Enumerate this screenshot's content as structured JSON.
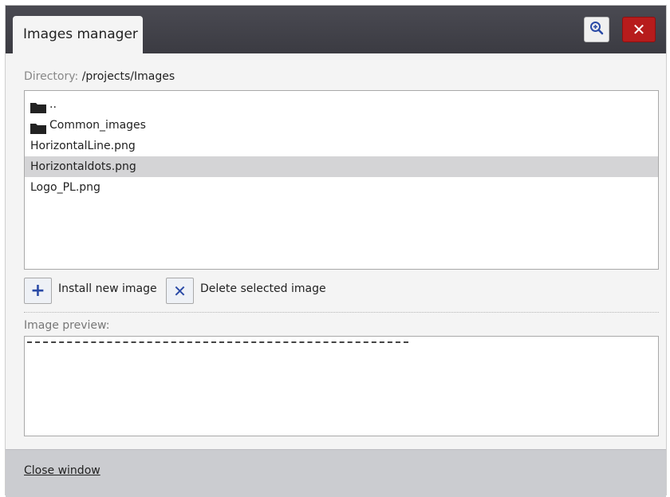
{
  "window": {
    "title": "Images manager"
  },
  "header": {
    "zoom_icon": "zoom-in-icon",
    "close_icon": "close-icon",
    "close_glyph": "✕",
    "close_color": "#b71c1c"
  },
  "directory": {
    "label": "Directory:",
    "path": "/projects/Images"
  },
  "files": [
    {
      "name": "..",
      "type": "folder"
    },
    {
      "name": "Common_images",
      "type": "folder"
    },
    {
      "name": "HorizontalLine.png",
      "type": "file"
    },
    {
      "name": "Horizontaldots.png",
      "type": "file",
      "selected": true
    },
    {
      "name": "Logo_PL.png",
      "type": "file"
    }
  ],
  "actions": {
    "install_label": "Install new image",
    "install_glyph": "+",
    "delete_label": "Delete selected image",
    "delete_glyph": "✕",
    "accent_color": "#2a4aa6"
  },
  "preview": {
    "label": "Image preview:"
  },
  "footer": {
    "close_link": "Close window"
  }
}
